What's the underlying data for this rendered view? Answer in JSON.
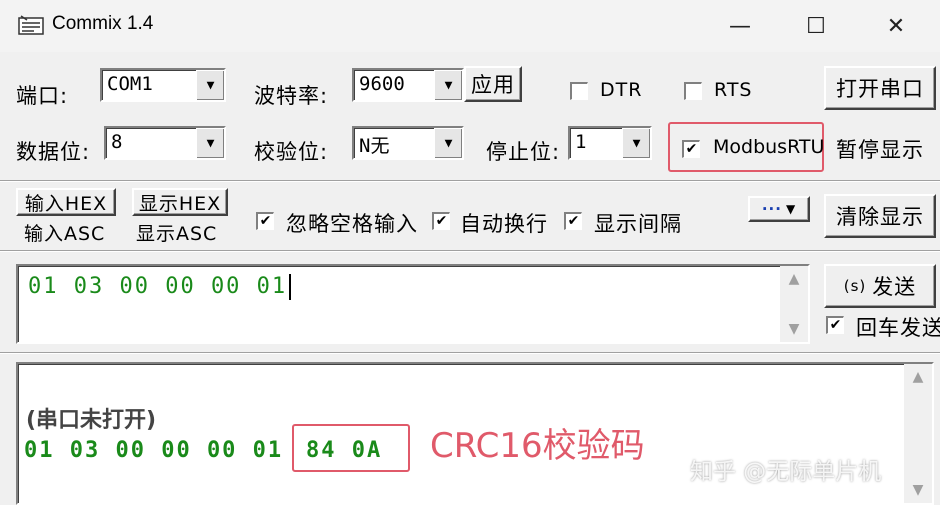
{
  "window": {
    "title": "Commix 1.4",
    "controls": {
      "minimize": "—",
      "maximize": "☐",
      "close": "✕"
    }
  },
  "serial": {
    "port_label": "端口:",
    "port_value": "COM1",
    "baud_label": "波特率:",
    "baud_value": "9600",
    "apply_label": "应用",
    "dtr_label": "DTR",
    "rts_label": "RTS",
    "open_port_label": "打开串口",
    "data_bits_label": "数据位:",
    "data_bits_value": "8",
    "parity_label": "校验位:",
    "parity_value": "N无",
    "stop_bits_label": "停止位:",
    "stop_bits_value": "1",
    "modbus_label": "ModbusRTU",
    "pause_label": "暂停显示"
  },
  "options": {
    "input_hex": "输入HEX",
    "input_asc": "输入ASC",
    "display_hex": "显示HEX",
    "display_asc": "显示ASC",
    "ignore_space": "忽略空格输入",
    "auto_newline": "自动换行",
    "show_interval": "显示间隔",
    "more_label": "···",
    "clear_label": "清除显示"
  },
  "send": {
    "input_text": "01 03 00 00 00 01",
    "send_label": "发送",
    "send_shortcut": "(s)",
    "enter_send_label": "回车发送"
  },
  "receive": {
    "status_text": "(串口未打开)",
    "data_text": "01 03 00 00 00 01",
    "crc_text": "84 0A",
    "annotation": "CRC16校验码"
  },
  "watermark": "知乎 @无际单片机",
  "colors": {
    "highlight": "#e05a6a",
    "data_green": "#1a8a1a"
  }
}
